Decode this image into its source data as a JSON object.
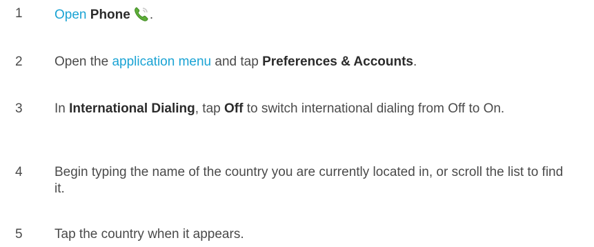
{
  "steps": [
    {
      "number": "1",
      "link": "Open",
      "space": " ",
      "bold": "Phone",
      "icon": "phone-icon",
      "end": "."
    },
    {
      "number": "2",
      "pre": "Open the ",
      "link": "application menu",
      "mid": " and tap ",
      "bold": "Preferences & Accounts",
      "end": "."
    },
    {
      "number": "3",
      "pre": "In ",
      "bold1": "International Dialing",
      "mid": ", tap ",
      "bold2": "Off",
      "post": " to switch international dialing from Off to On."
    },
    {
      "number": "4",
      "text": "Begin typing the name of the country you are currently located in, or scroll the list to find it."
    },
    {
      "number": "5",
      "text": "Tap the country when it appears."
    }
  ],
  "colors": {
    "link": "#1aa3d4",
    "text": "#4a4a4a",
    "bold": "#2b2b2b",
    "phone_icon_green": "#5fae3a"
  }
}
